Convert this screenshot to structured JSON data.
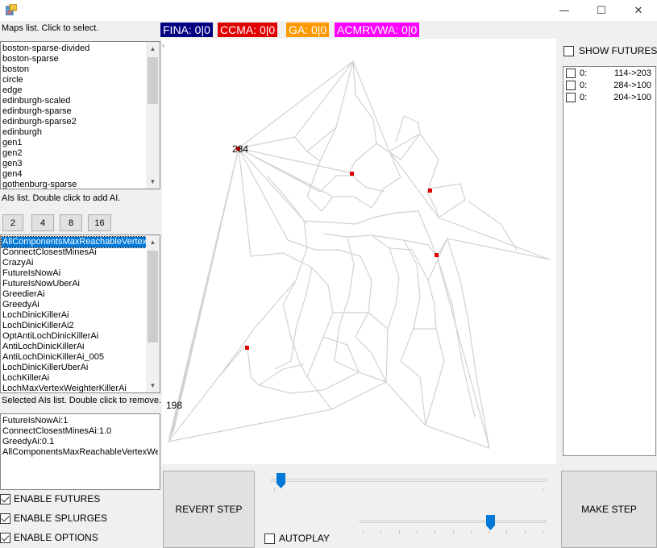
{
  "window": {
    "minimize_glyph": "—",
    "maximize_glyph": "☐",
    "close_glyph": "✕"
  },
  "maps": {
    "header": "Maps list. Click to select.",
    "items": [
      "boston-sparse-divided",
      "boston-sparse",
      "boston",
      "circle",
      "edge",
      "edinburgh-scaled",
      "edinburgh-sparse",
      "edinburgh-sparse2",
      "edinburgh",
      "gen1",
      "gen2",
      "gen3",
      "gen4",
      "gothenburg-sparse"
    ]
  },
  "ais": {
    "header": "AIs list. Double click to add AI.",
    "count_buttons": [
      "2",
      "4",
      "8",
      "16"
    ],
    "items": [
      "AllComponentsMaxReachableVertexW",
      "ConnectClosestMinesAi",
      "CrazyAi",
      "FutureIsNowAi",
      "FutureIsNowUberAi",
      "GreedierAi",
      "GreedyAi",
      "LochDinicKillerAi",
      "LochDinicKillerAi2",
      "OptAntiLochDinicKillerAi",
      "AntiLochDinicKillerAi",
      "AntiLochDinicKillerAi_005",
      "LochDinicKillerUberAi",
      "LochKillerAi",
      "LochMaxVertexWeighterKillerAi"
    ],
    "selected_index": 0
  },
  "selected_ais": {
    "header": "Selected AIs list. Double click to remove.",
    "items": [
      "FutureIsNowAi:1",
      "ConnectClosestMinesAi:1.0",
      "GreedyAi:0.1",
      "AllComponentsMaxReachableVertexWeigh"
    ]
  },
  "options": {
    "enable_futures": "ENABLE FUTURES",
    "enable_splurges": "ENABLE SPLURGES",
    "enable_options": "ENABLE OPTIONS"
  },
  "scores": [
    {
      "label": "FINA: 0|0",
      "color": "#000080"
    },
    {
      "label": "CCMA: 0|0",
      "color": "#e00000"
    },
    {
      "label": "GA: 0|0",
      "color": "#ff9900"
    },
    {
      "label": "ACMRVWA: 0|0",
      "color": "#ff00ff"
    }
  ],
  "map": {
    "corner_mark": "ⁱ",
    "node_labels": [
      "284",
      "198"
    ]
  },
  "futures": {
    "show_label": "SHOW FUTURES",
    "items": [
      {
        "player": "0:",
        "route": "114->203"
      },
      {
        "player": "0:",
        "route": "284->100"
      },
      {
        "player": "0:",
        "route": "204->100"
      }
    ]
  },
  "controls": {
    "revert": "REVERT STEP",
    "make": "MAKE STEP",
    "autoplay": "AUTOPLAY",
    "step_slider_fraction": 0.02,
    "speed_slider_fraction": 0.71
  }
}
